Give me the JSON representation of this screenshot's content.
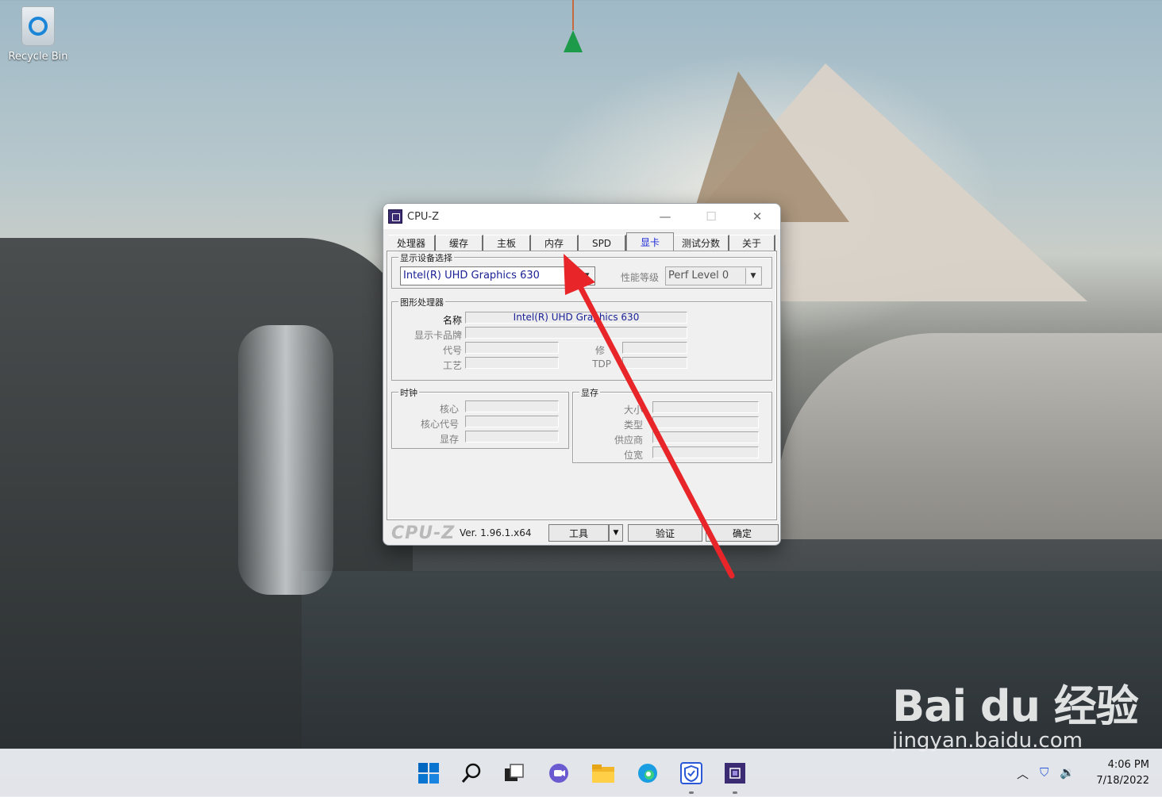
{
  "desktop": {
    "recycle_bin_label": "Recycle Bin"
  },
  "window": {
    "title": "CPU-Z",
    "controls": {
      "minimize": "—",
      "maximize": "☐",
      "close": "✕"
    },
    "tabs": [
      {
        "label": "处理器",
        "active": false
      },
      {
        "label": "缓存",
        "active": false
      },
      {
        "label": "主板",
        "active": false
      },
      {
        "label": "内存",
        "active": false
      },
      {
        "label": "SPD",
        "active": false
      },
      {
        "label": "显卡",
        "active": true
      },
      {
        "label": "测试分数",
        "active": false
      },
      {
        "label": "关于",
        "active": false
      }
    ],
    "display_select": {
      "legend": "显示设备选择",
      "device": "Intel(R) UHD Graphics 630",
      "perf_label": "性能等级",
      "perf_value": "Perf Level 0"
    },
    "gpu": {
      "legend": "图形处理器",
      "name_label": "名称",
      "name_value": "Intel(R) UHD Graphics 630",
      "brand_label": "显示卡品牌",
      "code_label": "代号",
      "revision_label": "修",
      "process_label": "工艺",
      "tdp_label": "TDP"
    },
    "clocks": {
      "legend": "时钟",
      "core_label": "核心",
      "shader_label": "核心代号",
      "memory_label": "显存"
    },
    "memory": {
      "legend": "显存",
      "size_label": "大小",
      "type_label": "类型",
      "vendor_label": "供应商",
      "bus_label": "位宽"
    },
    "footer": {
      "logo": "CPU-Z",
      "version": "Ver. 1.96.1.x64",
      "tools_button": "工具",
      "validate_button": "验证",
      "ok_button": "确定"
    }
  },
  "watermark": {
    "brand": "Bai du 经验",
    "url": "jingyan.baidu.com"
  },
  "taskbar": {
    "time": "4:06 PM",
    "date": "7/18/2022",
    "colors": {
      "accent": "#0067c0",
      "arrow": "#e8262a"
    }
  }
}
